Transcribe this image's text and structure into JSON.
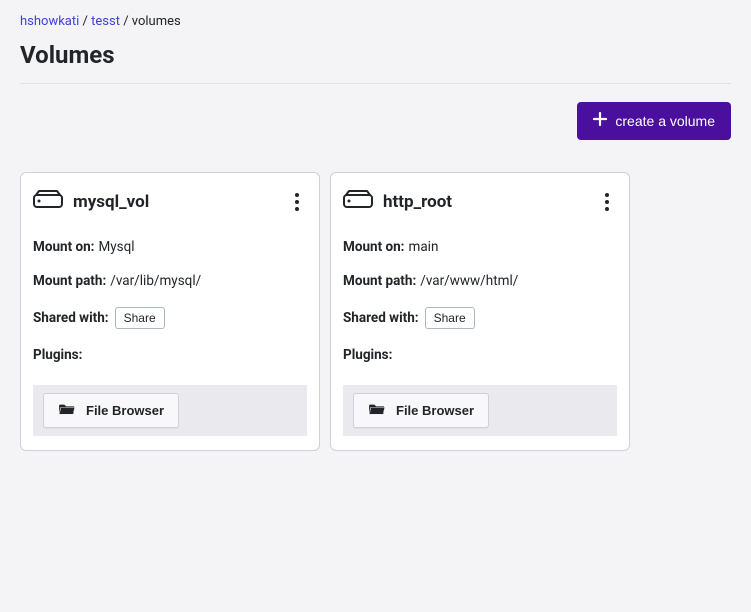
{
  "breadcrumb": {
    "parts": [
      "hshowkati",
      "tesst"
    ],
    "current": "volumes"
  },
  "page_title": "Volumes",
  "actions": {
    "create_label": "create a volume"
  },
  "labels": {
    "mount_on": "Mount on:",
    "mount_path": "Mount path:",
    "shared_with": "Shared with:",
    "plugins": "Plugins:",
    "share_button": "Share",
    "file_browser": "File Browser"
  },
  "volumes": [
    {
      "name": "mysql_vol",
      "mount_on": "Mysql",
      "mount_path": "/var/lib/mysql/"
    },
    {
      "name": "http_root",
      "mount_on": "main",
      "mount_path": "/var/www/html/"
    }
  ]
}
